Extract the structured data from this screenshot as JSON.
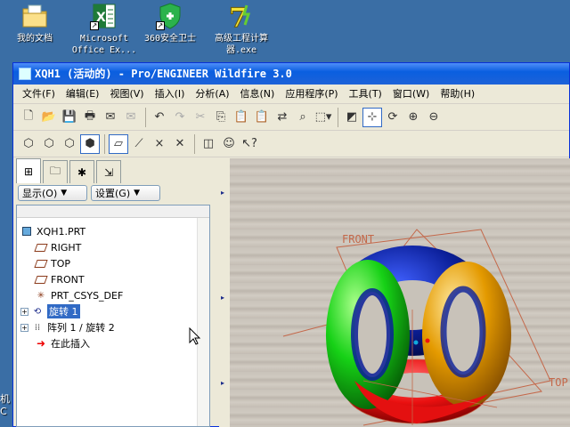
{
  "desktop": {
    "icons": [
      {
        "label": "我的文档",
        "icon": "folder-documents-icon"
      },
      {
        "label": "Microsoft Office Ex...",
        "icon": "excel-icon"
      },
      {
        "label": "360安全卫士",
        "icon": "shield-icon"
      },
      {
        "label": "高级工程计算器.exe",
        "icon": "calculator-icon"
      }
    ],
    "edge_text": "机 C"
  },
  "window": {
    "title": "XQH1 (活动的) - Pro/ENGINEER Wildfire 3.0"
  },
  "menu": [
    "文件(F)",
    "编辑(E)",
    "视图(V)",
    "插入(I)",
    "分析(A)",
    "信息(N)",
    "应用程序(P)",
    "工具(T)",
    "窗口(W)",
    "帮助(H)"
  ],
  "toolbar1": [
    "new-icon",
    "open-icon",
    "save-icon",
    "print-icon",
    "email-icon",
    "email-attach-icon",
    "undo-icon",
    "redo-icon",
    "cut-icon",
    "copy-icon",
    "paste-icon",
    "paste-special-icon",
    "regenerate-icon",
    "find-icon",
    "selection-box-icon",
    "view-manager-icon",
    "spin-center-icon",
    "refit-icon",
    "zoom-in-icon",
    "zoom-out-icon"
  ],
  "toolbar2": [
    "wireframe-icon",
    "hidden-line-icon",
    "no-hidden-icon",
    "shading-icon",
    "datum-plane-icon",
    "datum-axis-icon",
    "datum-point-icon",
    "csys-icon",
    "sketch-icon",
    "smiley-icon",
    "whats-this-icon"
  ],
  "left_panel": {
    "tabs": [
      "model-tree-tab-icon",
      "folder-browser-tab-icon",
      "favorites-tab-icon",
      "connections-tab-icon"
    ],
    "show_label": "显示(O)",
    "settings_label": "设置(G)",
    "tree": [
      {
        "label": "XQH1.PRT",
        "icon": "part-icon",
        "level": 0
      },
      {
        "label": "RIGHT",
        "icon": "datum-plane-icon",
        "level": 1
      },
      {
        "label": "TOP",
        "icon": "datum-plane-icon",
        "level": 1
      },
      {
        "label": "FRONT",
        "icon": "datum-plane-icon",
        "level": 1
      },
      {
        "label": "PRT_CSYS_DEF",
        "icon": "csys-icon",
        "level": 1
      },
      {
        "label": "旋转 1",
        "icon": "revolve-icon",
        "level": 1,
        "expandable": true,
        "selected": true
      },
      {
        "label": "阵列 1 / 旋转 2",
        "icon": "pattern-icon",
        "level": 1,
        "expandable": true
      },
      {
        "label": "在此插入",
        "icon": "insert-here-arrow-icon",
        "level": 1
      }
    ]
  },
  "graphics": {
    "labels": {
      "front": "FRONT",
      "top": "TOP"
    },
    "colors": {
      "blue": "#0b1f99",
      "green": "#16d116",
      "orange": "#e49a00",
      "red": "#ea1010",
      "datum": "#c4684a"
    }
  }
}
